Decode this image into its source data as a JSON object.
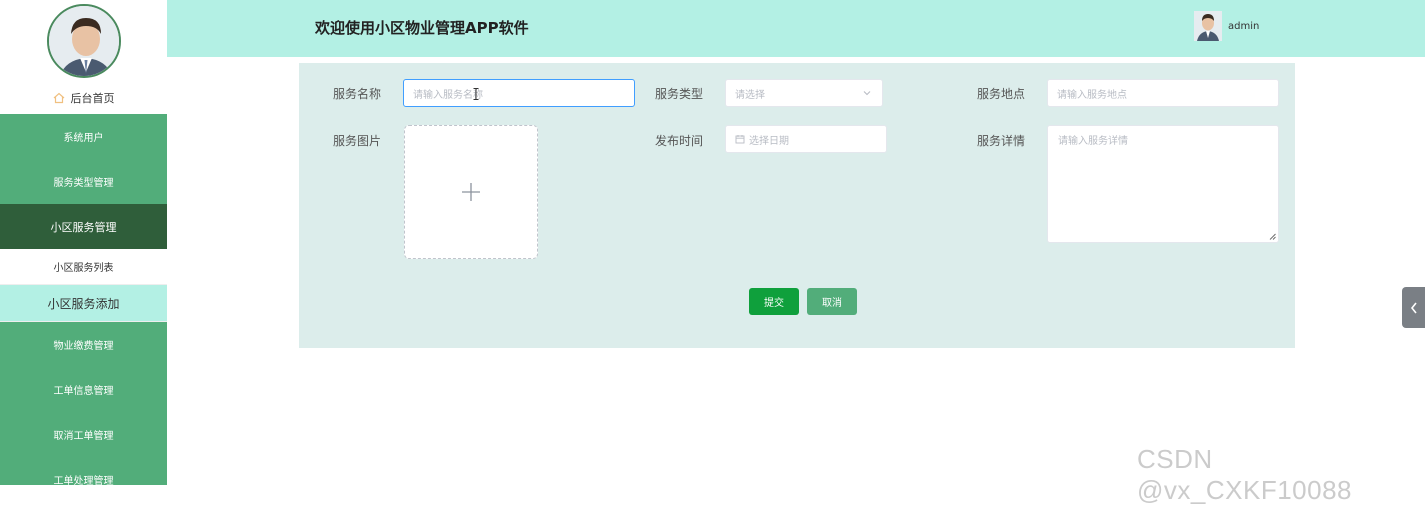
{
  "header": {
    "title": "欢迎使用小区物业管理APP软件",
    "username": "admin"
  },
  "sidebar": {
    "home": "后台首页",
    "items": [
      {
        "label": "系统用户"
      },
      {
        "label": "服务类型管理"
      },
      {
        "label": "小区服务管理"
      },
      {
        "label": "小区服务列表"
      },
      {
        "label": "小区服务添加"
      },
      {
        "label": "物业缴费管理"
      },
      {
        "label": "工单信息管理"
      },
      {
        "label": "取消工单管理"
      },
      {
        "label": "工单处理管理"
      }
    ]
  },
  "form": {
    "service_name": {
      "label": "服务名称",
      "placeholder": "请输入服务名称"
    },
    "service_type": {
      "label": "服务类型",
      "placeholder": "请选择"
    },
    "service_location": {
      "label": "服务地点",
      "placeholder": "请输入服务地点"
    },
    "service_image": {
      "label": "服务图片"
    },
    "publish_time": {
      "label": "发布时间",
      "placeholder": "选择日期"
    },
    "service_detail": {
      "label": "服务详情",
      "placeholder": "请输入服务详情"
    },
    "submit_label": "提交",
    "cancel_label": "取消"
  },
  "watermark": "CSDN @vx_CXKF10088",
  "colors": {
    "sidebar": "#52ad7a",
    "sidebar_active": "#2f5e3a",
    "header": "#b3f0e4",
    "panel": "#dcedeb",
    "submit": "#0fa03c"
  }
}
